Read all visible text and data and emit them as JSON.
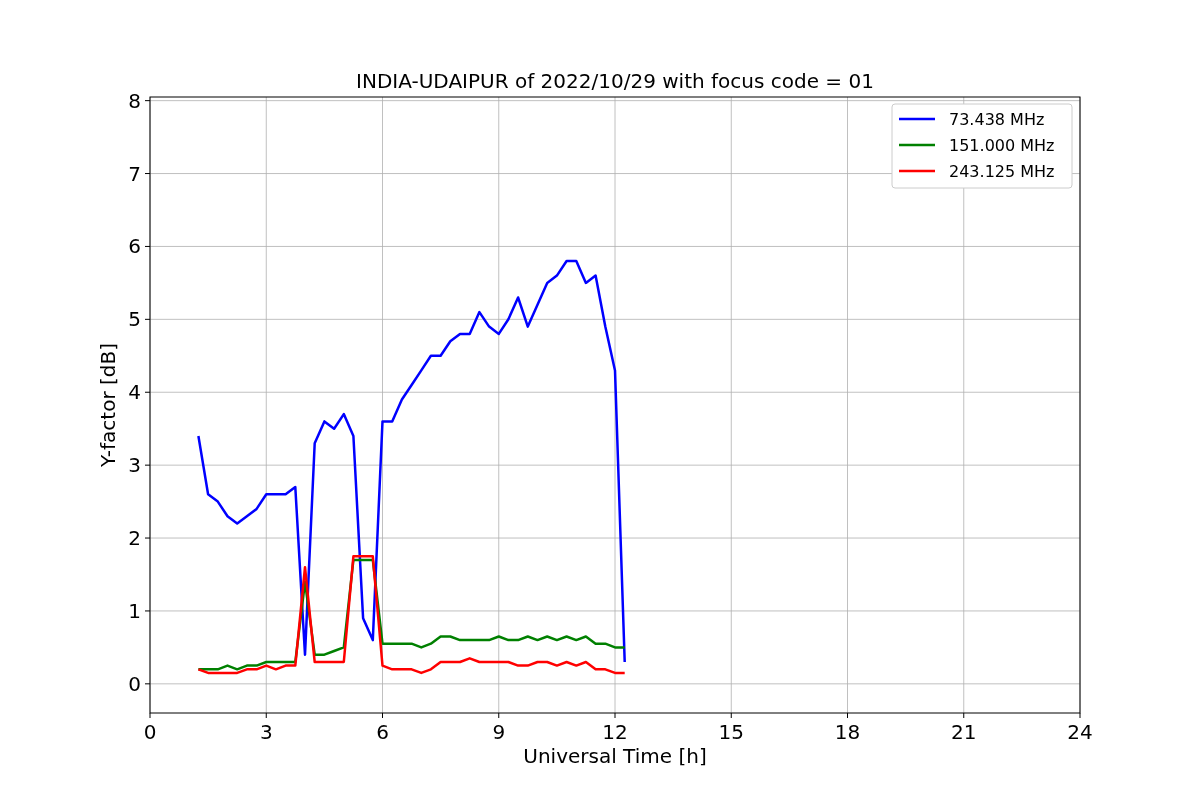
{
  "chart_data": {
    "type": "line",
    "title": "INDIA-UDAIPUR of 2022/10/29 with focus code = 01",
    "xlabel": "Universal Time [h]",
    "ylabel": "Y-factor [dB]",
    "x": [
      1.25,
      1.5,
      1.75,
      2.0,
      2.25,
      2.5,
      2.75,
      3.0,
      3.25,
      3.5,
      3.75,
      4.0,
      4.25,
      4.5,
      4.75,
      5.0,
      5.25,
      5.5,
      5.75,
      6.0,
      6.25,
      6.5,
      6.75,
      7.0,
      7.25,
      7.5,
      7.75,
      8.0,
      8.25,
      8.5,
      8.75,
      9.0,
      9.25,
      9.5,
      9.75,
      10.0,
      10.25,
      10.5,
      10.75,
      11.0,
      11.25,
      11.5,
      11.75,
      12.0,
      12.25
    ],
    "series": [
      {
        "name": "  73.438 MHz",
        "color": "#0000ff",
        "values": [
          3.4,
          2.6,
          2.5,
          2.3,
          2.2,
          2.3,
          2.4,
          2.6,
          2.6,
          2.6,
          2.7,
          0.4,
          3.3,
          3.6,
          3.5,
          3.7,
          3.4,
          0.9,
          0.6,
          3.6,
          3.6,
          3.9,
          4.1,
          4.3,
          4.5,
          4.5,
          4.7,
          4.8,
          4.8,
          5.1,
          4.9,
          4.8,
          5.0,
          5.3,
          4.9,
          5.2,
          5.5,
          5.6,
          5.8,
          5.8,
          5.5,
          5.6,
          4.9,
          4.3,
          0.3
        ]
      },
      {
        "name": "151.000 MHz",
        "color": "#008000",
        "values": [
          0.2,
          0.2,
          0.2,
          0.25,
          0.2,
          0.25,
          0.25,
          0.3,
          0.3,
          0.3,
          0.3,
          1.4,
          0.4,
          0.4,
          0.45,
          0.5,
          1.7,
          1.7,
          1.7,
          0.55,
          0.55,
          0.55,
          0.55,
          0.5,
          0.55,
          0.65,
          0.65,
          0.6,
          0.6,
          0.6,
          0.6,
          0.65,
          0.6,
          0.6,
          0.65,
          0.6,
          0.65,
          0.6,
          0.65,
          0.6,
          0.65,
          0.55,
          0.55,
          0.5,
          0.5
        ]
      },
      {
        "name": "243.125 MHz",
        "color": "#ff0000",
        "values": [
          0.2,
          0.15,
          0.15,
          0.15,
          0.15,
          0.2,
          0.2,
          0.25,
          0.2,
          0.25,
          0.25,
          1.6,
          0.3,
          0.3,
          0.3,
          0.3,
          1.75,
          1.75,
          1.75,
          0.25,
          0.2,
          0.2,
          0.2,
          0.15,
          0.2,
          0.3,
          0.3,
          0.3,
          0.35,
          0.3,
          0.3,
          0.3,
          0.3,
          0.25,
          0.25,
          0.3,
          0.3,
          0.25,
          0.3,
          0.25,
          0.3,
          0.2,
          0.2,
          0.15,
          0.15
        ]
      }
    ],
    "xlim": [
      0,
      24
    ],
    "ylim": [
      -0.4,
      8.05
    ],
    "xticks": [
      0,
      3,
      6,
      9,
      12,
      15,
      18,
      21,
      24
    ],
    "yticks": [
      0,
      1,
      2,
      3,
      4,
      5,
      6,
      7,
      8
    ],
    "grid": true,
    "legend": true
  }
}
